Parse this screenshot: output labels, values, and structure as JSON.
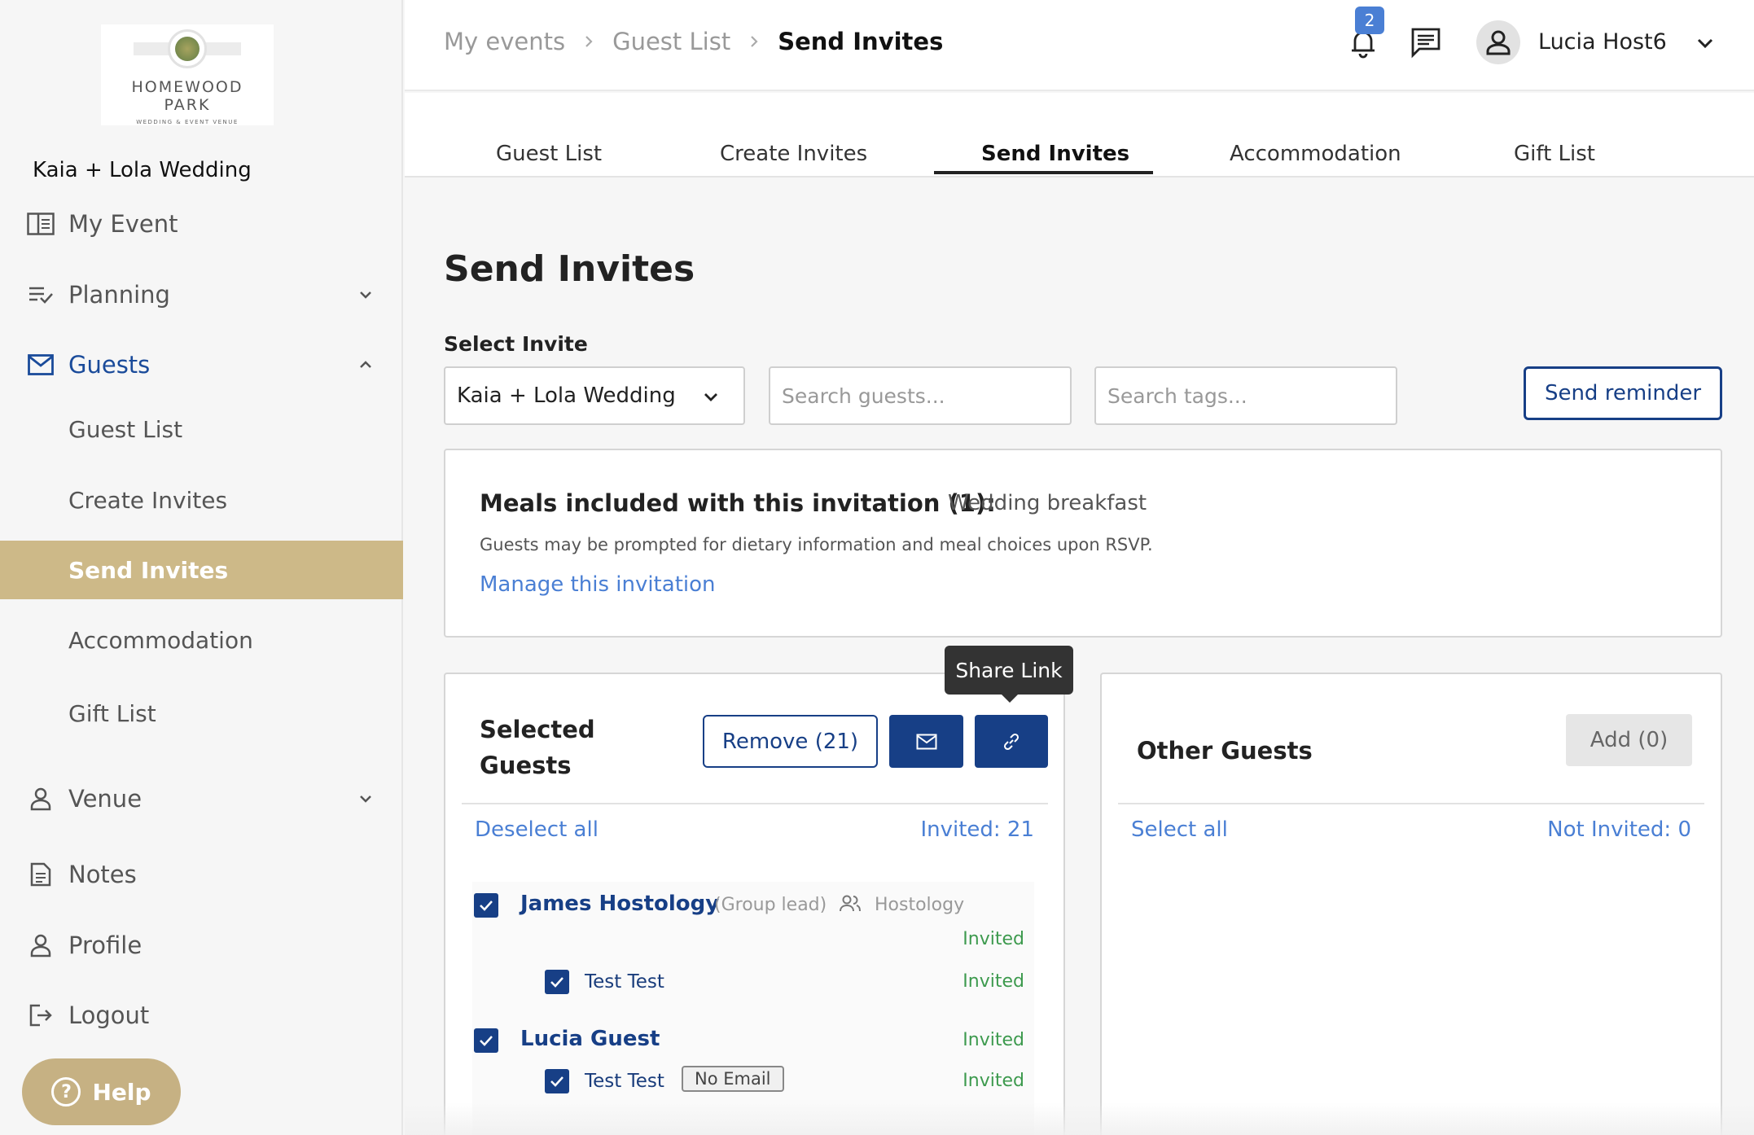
{
  "brand": {
    "line1": "HOMEWOOD",
    "line2": "PARK",
    "line3": "WEDDING & EVENT VENUE"
  },
  "sidebar": {
    "event_name": "Kaia + Lola Wedding",
    "items": [
      {
        "label": "My Event",
        "icon": "book-open-icon"
      },
      {
        "label": "Planning",
        "icon": "checklist-icon"
      },
      {
        "label": "Guests",
        "icon": "mail-icon"
      },
      {
        "label": "Venue",
        "icon": "person-icon"
      },
      {
        "label": "Notes",
        "icon": "document-icon"
      },
      {
        "label": "Profile",
        "icon": "person-icon"
      },
      {
        "label": "Logout",
        "icon": "logout-icon"
      }
    ],
    "guests_sub": [
      "Guest List",
      "Create Invites",
      "Send Invites",
      "Accommodation",
      "Gift List"
    ],
    "help_label": "Help",
    "accent": "#cdb988"
  },
  "header": {
    "breadcrumb": [
      "My events",
      "Guest List",
      "Send Invites"
    ],
    "notification_count": "2",
    "username": "Lucia Host6"
  },
  "tabs": [
    "Guest List",
    "Create Invites",
    "Send Invites",
    "Accommodation",
    "Gift List"
  ],
  "main": {
    "title": "Send Invites",
    "select_label": "Select Invite",
    "select_value": "Kaia + Lola Wedding",
    "search_guests_placeholder": "Search guests...",
    "search_tags_placeholder": "Search tags...",
    "send_reminder": "Send reminder",
    "meals": {
      "title": "Meals included with this invitation (1):",
      "value": "Wedding breakfast",
      "note": "Guests may be prompted for dietary information and meal choices upon RSVP.",
      "link": "Manage this invitation"
    },
    "selected": {
      "title_line1": "Selected",
      "title_line2": "Guests",
      "remove_label": "Remove (21)",
      "tooltip": "Share Link",
      "deselect_all": "Deselect all",
      "invited_count": "Invited: 21",
      "guests": [
        {
          "name": "James Hostology",
          "role": "(Group lead)",
          "group": "Hostology",
          "status": "Invited",
          "members": [
            {
              "name": "Test Test",
              "status": "Invited"
            }
          ]
        },
        {
          "name": "Lucia Guest",
          "status": "Invited",
          "members": [
            {
              "name": "Test Test",
              "tag": "No Email",
              "status": "Invited"
            }
          ]
        }
      ]
    },
    "other": {
      "title": "Other Guests",
      "add_label": "Add (0)",
      "select_all": "Select all",
      "not_invited_count": "Not Invited: 0"
    }
  },
  "colors": {
    "primary": "#173f86",
    "link": "#4a7fd4",
    "success": "#3d9a4e"
  }
}
